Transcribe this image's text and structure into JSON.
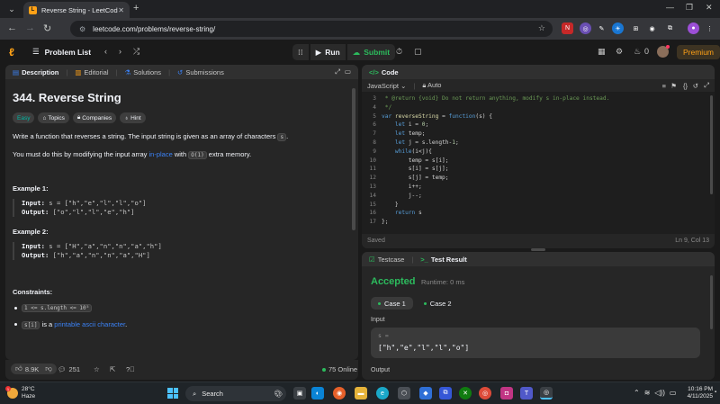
{
  "browser": {
    "tab_title": "Reverse String - LeetCode",
    "url": "leetcode.com/problems/reverse-string/"
  },
  "header": {
    "problem_list": "Problem List",
    "run": "Run",
    "submit": "Submit",
    "streak_count": "0",
    "premium": "Premium"
  },
  "description": {
    "tabs": [
      {
        "label": "Description"
      },
      {
        "label": "Editorial"
      },
      {
        "label": "Solutions"
      },
      {
        "label": "Submissions"
      }
    ],
    "title": "344. Reverse String",
    "tags": [
      "Easy",
      "Topics",
      "Companies",
      "Hint"
    ],
    "para1_a": "Write a function that reverses a string. The input string is given as an array of characters ",
    "para1_code": "s",
    "para1_b": ".",
    "para2_a": "You must do this by modifying the input array ",
    "para2_link": "in-place",
    "para2_b": " with ",
    "para2_code": "O(1)",
    "para2_c": " extra memory.",
    "example1_title": "Example 1:",
    "example1_input_label": "Input:",
    "example1_input": "s = [\"h\",\"e\",\"l\",\"l\",\"o\"]",
    "example1_output_label": "Output:",
    "example1_output": "[\"o\",\"l\",\"l\",\"e\",\"h\"]",
    "example2_title": "Example 2:",
    "example2_input_label": "Input:",
    "example2_input": "s = [\"H\",\"a\",\"n\",\"n\",\"a\",\"h\"]",
    "example2_output_label": "Output:",
    "example2_output": "[\"h\",\"a\",\"n\",\"n\",\"a\",\"H\"]",
    "constraints_title": "Constraints:",
    "constraint1_code": "1 <= s.length <= 10⁵",
    "constraint2_code": "s[i]",
    "constraint2_text": " is a ",
    "constraint2_link": "printable ascii character",
    "constraint2_end": "."
  },
  "desc_footer": {
    "likes": "8.9K",
    "comments": "251",
    "online": "75 Online"
  },
  "code": {
    "title": "Code",
    "language": "JavaScript",
    "auto": "Auto",
    "lines": [
      {
        "n": "3",
        "t": " * @return {void} Do not return anything, modify s in-place instead.",
        "cls": "c-com"
      },
      {
        "n": "4",
        "t": " */",
        "cls": "c-com"
      },
      {
        "n": "5",
        "t": "var reverseString = function(s) {",
        "cls": "mix5"
      },
      {
        "n": "6",
        "t": "    let i = 0;",
        "cls": "mix"
      },
      {
        "n": "7",
        "t": "    let temp;",
        "cls": "mix"
      },
      {
        "n": "8",
        "t": "    let j = s.length-1;",
        "cls": "mix"
      },
      {
        "n": "9",
        "t": "    while(i<j){",
        "cls": "mix"
      },
      {
        "n": "10",
        "t": "        temp = s[i];",
        "cls": "src"
      },
      {
        "n": "11",
        "t": "        s[i] = s[j];",
        "cls": "src"
      },
      {
        "n": "12",
        "t": "        s[j] = temp;",
        "cls": "src"
      },
      {
        "n": "13",
        "t": "        i++;",
        "cls": "src"
      },
      {
        "n": "14",
        "t": "        j--;",
        "cls": "src"
      },
      {
        "n": "15",
        "t": "    }",
        "cls": "src"
      },
      {
        "n": "16",
        "t": "    return s",
        "cls": "mix"
      },
      {
        "n": "17",
        "t": "};",
        "cls": "src"
      }
    ],
    "saved": "Saved",
    "cursor": "Ln 9, Col 13"
  },
  "result": {
    "tabs": [
      {
        "label": "Testcase"
      },
      {
        "label": "Test Result"
      }
    ],
    "status": "Accepted",
    "runtime": "Runtime: 0 ms",
    "case1": "Case 1",
    "case2": "Case 2",
    "input_label": "Input",
    "var_name": "s =",
    "input_value": "[\"h\",\"e\",\"l\",\"l\",\"o\"]",
    "output_label": "Output"
  },
  "taskbar": {
    "temp": "28°C",
    "weather": "Haze",
    "search": "Search",
    "time": "10:16 PM",
    "date": "4/11/2025"
  },
  "colors": {
    "accent": "#ffa116",
    "accepted": "#2cbb5d",
    "easy": "#00b8a3",
    "link": "#3b82f6"
  }
}
